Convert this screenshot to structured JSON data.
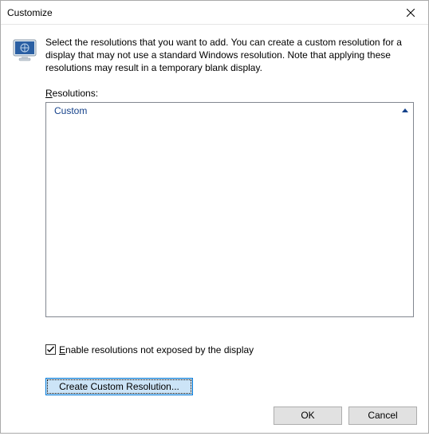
{
  "window": {
    "title": "Customize"
  },
  "description": "Select the resolutions that you want to add. You can create a custom resolution for a display that may not use a standard Windows resolution. Note that applying these resolutions may result in a temporary blank display.",
  "resolutions": {
    "label_prefix": "R",
    "label_rest": "esolutions:",
    "group_header": "Custom"
  },
  "checkbox": {
    "checked": true,
    "label_prefix": "E",
    "label_rest": "nable resolutions not exposed by the display"
  },
  "buttons": {
    "create": "Create Custom Resolution...",
    "ok": "OK",
    "cancel": "Cancel"
  },
  "icons": {
    "close": "close-icon",
    "monitor": "monitor-icon",
    "caret_up": "caret-up-icon",
    "checkmark": "checkmark-icon"
  }
}
